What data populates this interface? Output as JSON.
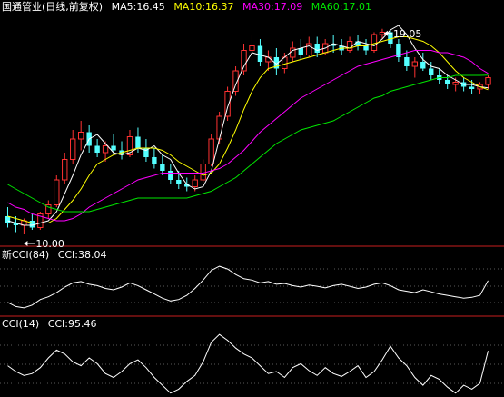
{
  "header": {
    "stock": "国通管业(日线,前复权)",
    "ma5": "MA5:16.45",
    "ma10": "MA10:16.37",
    "ma30": "MA30:17.09",
    "ma60": "MA60:17.01"
  },
  "annotations": {
    "low": "10.00",
    "high": "19.05"
  },
  "cci84_header": {
    "title": "新CCI(84)",
    "value": "CCI:38.04"
  },
  "cci14_header": {
    "title": "CCI(14)",
    "value": "CCI:95.46"
  },
  "colors": {
    "up": "#ff3232",
    "down": "#54ffff",
    "ma5": "#ffffff",
    "ma10": "#ffff00",
    "ma30": "#ff00ff",
    "ma60": "#00e600",
    "separator": "#c81e1e",
    "grid": "#b4b4b4",
    "background": "#000000"
  },
  "chart_data": [
    {
      "type": "candlestick",
      "series": [
        {
          "name": "MA5",
          "values": [
            10.6,
            10.5,
            10.4,
            10.4,
            10.5,
            10.6,
            11.0,
            11.8,
            12.6,
            13.5,
            14.2,
            14.4,
            14.0,
            13.6,
            13.5,
            13.6,
            13.8,
            13.7,
            13.9,
            13.5,
            13.3,
            12.7,
            12.2,
            12.0,
            12.1,
            12.8,
            14.2,
            15.6,
            16.6,
            17.4,
            18.0,
            17.9,
            17.8,
            17.5,
            17.8,
            18.1,
            18.2,
            18.3,
            18.1,
            18.2,
            18.4,
            18.3,
            18.2,
            18.5,
            18.4,
            18.3,
            18.6,
            19.0,
            19.2,
            18.8,
            18.2,
            17.7,
            17.4,
            17.3,
            17.0,
            16.8,
            16.6,
            16.6,
            16.5,
            16.45
          ]
        },
        {
          "name": "MA10",
          "values": [
            10.8,
            10.7,
            10.6,
            10.5,
            10.5,
            10.5,
            10.7,
            11.1,
            11.5,
            12.0,
            12.6,
            13.1,
            13.3,
            13.5,
            13.6,
            13.7,
            13.8,
            13.8,
            13.8,
            13.7,
            13.5,
            13.2,
            13.0,
            12.8,
            12.6,
            12.7,
            13.1,
            13.8,
            14.6,
            15.5,
            16.3,
            16.9,
            17.3,
            17.4,
            17.5,
            17.6,
            17.7,
            17.8,
            17.9,
            18.0,
            18.1,
            18.2,
            18.2,
            18.3,
            18.3,
            18.4,
            18.5,
            18.6,
            18.7,
            18.7,
            18.6,
            18.5,
            18.3,
            18.0,
            17.6,
            17.2,
            16.9,
            16.7,
            16.5,
            16.37
          ]
        },
        {
          "name": "MA30",
          "values": [
            11.4,
            11.2,
            11.1,
            10.9,
            10.8,
            10.7,
            10.6,
            10.6,
            10.7,
            10.9,
            11.2,
            11.4,
            11.6,
            11.8,
            12.0,
            12.2,
            12.4,
            12.5,
            12.6,
            12.7,
            12.7,
            12.7,
            12.7,
            12.7,
            12.7,
            12.8,
            12.9,
            13.1,
            13.4,
            13.7,
            14.1,
            14.5,
            14.8,
            15.1,
            15.4,
            15.7,
            16.0,
            16.2,
            16.4,
            16.6,
            16.8,
            17.0,
            17.2,
            17.4,
            17.5,
            17.6,
            17.7,
            17.8,
            17.9,
            18.0,
            18.1,
            18.1,
            18.1,
            18.0,
            18.0,
            17.9,
            17.8,
            17.6,
            17.3,
            17.09
          ]
        },
        {
          "name": "MA60",
          "values": [
            12.2,
            12.0,
            11.8,
            11.6,
            11.4,
            11.2,
            11.1,
            11.0,
            11.0,
            11.0,
            11.0,
            11.1,
            11.2,
            11.3,
            11.4,
            11.5,
            11.6,
            11.6,
            11.6,
            11.6,
            11.6,
            11.6,
            11.6,
            11.7,
            11.8,
            11.9,
            12.1,
            12.3,
            12.5,
            12.8,
            13.1,
            13.4,
            13.7,
            14.0,
            14.2,
            14.4,
            14.6,
            14.7,
            14.8,
            14.9,
            15.0,
            15.2,
            15.4,
            15.6,
            15.8,
            16.0,
            16.1,
            16.3,
            16.4,
            16.5,
            16.6,
            16.7,
            16.8,
            16.9,
            16.9,
            17.0,
            17.0,
            17.0,
            17.0,
            17.01
          ]
        }
      ],
      "candles": [
        {
          "o": 10.8,
          "h": 11.2,
          "l": 10.3,
          "c": 10.5
        },
        {
          "o": 10.5,
          "h": 10.8,
          "l": 10.1,
          "c": 10.4
        },
        {
          "o": 10.4,
          "h": 10.7,
          "l": 10.0,
          "c": 10.6
        },
        {
          "o": 10.6,
          "h": 10.9,
          "l": 10.2,
          "c": 10.3
        },
        {
          "o": 10.3,
          "h": 11.0,
          "l": 10.2,
          "c": 10.9
        },
        {
          "o": 10.9,
          "h": 11.5,
          "l": 10.7,
          "c": 11.3
        },
        {
          "o": 11.3,
          "h": 12.6,
          "l": 11.2,
          "c": 12.4
        },
        {
          "o": 12.4,
          "h": 13.6,
          "l": 12.2,
          "c": 13.3
        },
        {
          "o": 13.3,
          "h": 14.6,
          "l": 13.1,
          "c": 14.2
        },
        {
          "o": 14.2,
          "h": 15.0,
          "l": 13.7,
          "c": 14.5
        },
        {
          "o": 14.5,
          "h": 14.8,
          "l": 13.6,
          "c": 13.9
        },
        {
          "o": 13.9,
          "h": 14.2,
          "l": 13.4,
          "c": 13.6
        },
        {
          "o": 13.6,
          "h": 14.1,
          "l": 13.2,
          "c": 13.9
        },
        {
          "o": 13.9,
          "h": 14.4,
          "l": 13.5,
          "c": 13.7
        },
        {
          "o": 13.7,
          "h": 14.1,
          "l": 13.3,
          "c": 13.5
        },
        {
          "o": 13.5,
          "h": 14.6,
          "l": 13.4,
          "c": 14.3
        },
        {
          "o": 14.3,
          "h": 14.7,
          "l": 13.6,
          "c": 13.8
        },
        {
          "o": 13.8,
          "h": 14.2,
          "l": 13.2,
          "c": 13.4
        },
        {
          "o": 13.4,
          "h": 13.8,
          "l": 12.9,
          "c": 13.1
        },
        {
          "o": 13.1,
          "h": 13.5,
          "l": 12.6,
          "c": 12.8
        },
        {
          "o": 12.8,
          "h": 13.1,
          "l": 12.2,
          "c": 12.4
        },
        {
          "o": 12.4,
          "h": 12.8,
          "l": 12.0,
          "c": 12.2
        },
        {
          "o": 12.2,
          "h": 12.5,
          "l": 11.9,
          "c": 12.1
        },
        {
          "o": 12.1,
          "h": 12.6,
          "l": 11.9,
          "c": 12.4
        },
        {
          "o": 12.4,
          "h": 13.3,
          "l": 12.3,
          "c": 13.1
        },
        {
          "o": 13.1,
          "h": 14.4,
          "l": 13.0,
          "c": 14.2
        },
        {
          "o": 14.2,
          "h": 15.4,
          "l": 14.0,
          "c": 15.2
        },
        {
          "o": 15.2,
          "h": 16.5,
          "l": 15.0,
          "c": 16.3
        },
        {
          "o": 16.3,
          "h": 17.4,
          "l": 16.1,
          "c": 17.2
        },
        {
          "o": 17.2,
          "h": 18.4,
          "l": 17.0,
          "c": 18.1
        },
        {
          "o": 18.1,
          "h": 18.8,
          "l": 17.6,
          "c": 18.3
        },
        {
          "o": 18.3,
          "h": 18.6,
          "l": 17.4,
          "c": 17.6
        },
        {
          "o": 17.6,
          "h": 18.1,
          "l": 17.2,
          "c": 17.8
        },
        {
          "o": 17.8,
          "h": 18.2,
          "l": 17.0,
          "c": 17.3
        },
        {
          "o": 17.3,
          "h": 18.0,
          "l": 17.1,
          "c": 17.8
        },
        {
          "o": 17.8,
          "h": 18.5,
          "l": 17.6,
          "c": 18.2
        },
        {
          "o": 18.2,
          "h": 18.6,
          "l": 17.7,
          "c": 17.9
        },
        {
          "o": 17.9,
          "h": 18.7,
          "l": 17.8,
          "c": 18.4
        },
        {
          "o": 18.4,
          "h": 18.7,
          "l": 17.8,
          "c": 18.0
        },
        {
          "o": 18.0,
          "h": 18.6,
          "l": 17.9,
          "c": 18.4
        },
        {
          "o": 18.4,
          "h": 18.8,
          "l": 18.0,
          "c": 18.3
        },
        {
          "o": 18.3,
          "h": 18.6,
          "l": 17.9,
          "c": 18.1
        },
        {
          "o": 18.1,
          "h": 18.7,
          "l": 18.0,
          "c": 18.5
        },
        {
          "o": 18.5,
          "h": 18.8,
          "l": 18.1,
          "c": 18.3
        },
        {
          "o": 18.3,
          "h": 18.6,
          "l": 17.9,
          "c": 18.1
        },
        {
          "o": 18.1,
          "h": 18.9,
          "l": 18.0,
          "c": 18.8
        },
        {
          "o": 18.8,
          "h": 19.05,
          "l": 18.6,
          "c": 18.9
        },
        {
          "o": 18.9,
          "h": 19.0,
          "l": 18.2,
          "c": 18.4
        },
        {
          "o": 18.4,
          "h": 18.6,
          "l": 17.6,
          "c": 17.8
        },
        {
          "o": 17.8,
          "h": 18.1,
          "l": 17.2,
          "c": 17.4
        },
        {
          "o": 17.4,
          "h": 17.8,
          "l": 16.9,
          "c": 17.6
        },
        {
          "o": 17.6,
          "h": 18.0,
          "l": 17.2,
          "c": 17.3
        },
        {
          "o": 17.3,
          "h": 17.6,
          "l": 16.8,
          "c": 17.0
        },
        {
          "o": 17.0,
          "h": 17.3,
          "l": 16.6,
          "c": 16.8
        },
        {
          "o": 16.8,
          "h": 17.0,
          "l": 16.4,
          "c": 16.6
        },
        {
          "o": 16.6,
          "h": 16.9,
          "l": 16.3,
          "c": 16.7
        },
        {
          "o": 16.7,
          "h": 16.9,
          "l": 16.3,
          "c": 16.5
        },
        {
          "o": 16.5,
          "h": 16.8,
          "l": 16.2,
          "c": 16.4
        },
        {
          "o": 16.4,
          "h": 16.7,
          "l": 16.2,
          "c": 16.6
        },
        {
          "o": 16.6,
          "h": 17.0,
          "l": 16.4,
          "c": 16.9
        }
      ]
    },
    {
      "type": "line",
      "series": [
        {
          "name": "新CCI(84)",
          "values": [
            -40,
            -55,
            -60,
            -50,
            -30,
            -20,
            -5,
            15,
            30,
            35,
            25,
            20,
            10,
            5,
            15,
            30,
            20,
            5,
            -10,
            -25,
            -35,
            -30,
            -15,
            10,
            40,
            75,
            90,
            80,
            60,
            45,
            40,
            30,
            35,
            25,
            28,
            20,
            15,
            22,
            18,
            12,
            20,
            25,
            18,
            10,
            15,
            25,
            30,
            20,
            5,
            0,
            -5,
            5,
            -2,
            -10,
            -15,
            -20,
            -25,
            -22,
            -15,
            38
          ]
        }
      ]
    },
    {
      "type": "line",
      "series": [
        {
          "name": "CCI(14)",
          "values": [
            20,
            -10,
            -30,
            -20,
            10,
            60,
            100,
            80,
            40,
            20,
            60,
            30,
            -20,
            -40,
            -10,
            30,
            50,
            10,
            -40,
            -80,
            -120,
            -100,
            -60,
            -30,
            40,
            140,
            180,
            150,
            110,
            80,
            60,
            20,
            -20,
            -10,
            -40,
            10,
            30,
            -5,
            -30,
            10,
            -20,
            -35,
            -10,
            20,
            -40,
            -10,
            50,
            120,
            60,
            20,
            -40,
            -80,
            -30,
            -50,
            -90,
            -120,
            -80,
            -100,
            -70,
            95.46
          ]
        }
      ]
    }
  ]
}
